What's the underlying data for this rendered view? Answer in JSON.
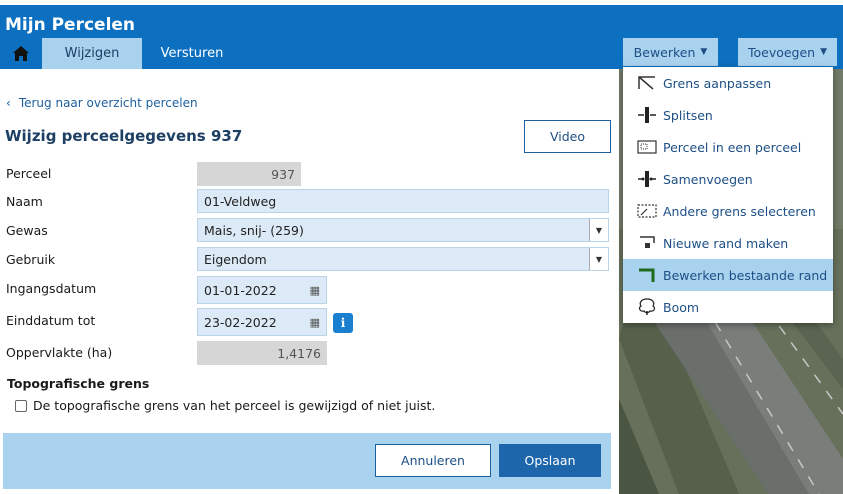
{
  "app": {
    "title": "Mijn Percelen"
  },
  "tabs": [
    {
      "label": "Wijzigen"
    },
    {
      "label": "Versturen"
    }
  ],
  "header_buttons": {
    "bewerken": "Bewerken",
    "toevoegen": "Toevoegen"
  },
  "menu": {
    "items": [
      {
        "label": "Grens aanpassen",
        "icon": "edit-boundary-icon"
      },
      {
        "label": "Splitsen",
        "icon": "split-icon"
      },
      {
        "label": "Perceel in een perceel",
        "icon": "parcel-in-parcel-icon"
      },
      {
        "label": "Samenvoegen",
        "icon": "merge-icon"
      },
      {
        "label": "Andere grens selecteren",
        "icon": "select-boundary-icon"
      },
      {
        "label": "Nieuwe rand maken",
        "icon": "new-edge-icon"
      },
      {
        "label": "Bewerken bestaande rand",
        "icon": "edit-edge-icon"
      },
      {
        "label": "Boom",
        "icon": "tree-icon"
      }
    ],
    "active_index": 6
  },
  "panel": {
    "back_link": "Terug naar overzicht percelen",
    "title": "Wijzig perceelgegevens 937",
    "video_button": "Video"
  },
  "form": {
    "perceel": {
      "label": "Perceel",
      "value": "937"
    },
    "naam": {
      "label": "Naam",
      "value": "01-Veldweg"
    },
    "gewas": {
      "label": "Gewas",
      "value": "Mais, snij- (259)"
    },
    "gebruik": {
      "label": "Gebruik",
      "value": "Eigendom"
    },
    "ingangsdatum": {
      "label": "Ingangsdatum",
      "value": "01-01-2022"
    },
    "einddatum": {
      "label": "Einddatum tot",
      "value": "23-02-2022"
    },
    "oppervlakte": {
      "label": "Oppervlakte (ha)",
      "value": "1,4176"
    }
  },
  "topo": {
    "title": "Topografische grens",
    "checkbox_label": "De topografische grens van het perceel is gewijzigd of niet juist.",
    "checked": false
  },
  "footer": {
    "cancel": "Annuleren",
    "save": "Opslaan"
  },
  "colors": {
    "header_bg": "#0c6fbf",
    "accent_light": "#a9d2ee",
    "primary_button": "#1d66ac"
  }
}
